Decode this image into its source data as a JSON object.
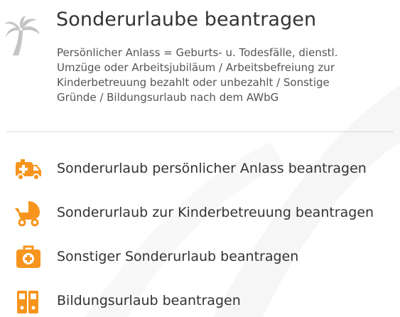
{
  "colors": {
    "accent": "#f7941d",
    "icon_grey": "#c4c4c4",
    "text": "#333333"
  },
  "header": {
    "icon": "palm-tree-icon",
    "title": "Sonderurlaube beantragen",
    "description_lines": [
      "Persönlicher Anlass = Geburts- u. Todesfälle, dienstl.",
      "Umzüge oder Arbeitsjubiläum / Arbeitsbefreiung zur",
      "Kinderbetreuung bezahlt oder unbezahlt / Sonstige",
      "Gründe / Bildungsurlaub nach dem AWbG"
    ]
  },
  "menu": {
    "items": [
      {
        "icon": "ambulance-icon",
        "label": "Sonderurlaub persönlicher Anlass beantragen"
      },
      {
        "icon": "stroller-icon",
        "label": "Sonderurlaub zur Kinderbetreuung beantragen"
      },
      {
        "icon": "medical-kit-icon",
        "label": "Sonstiger Sonderurlaub beantragen"
      },
      {
        "icon": "binders-icon",
        "label": "Bildungsurlaub beantragen"
      }
    ]
  }
}
